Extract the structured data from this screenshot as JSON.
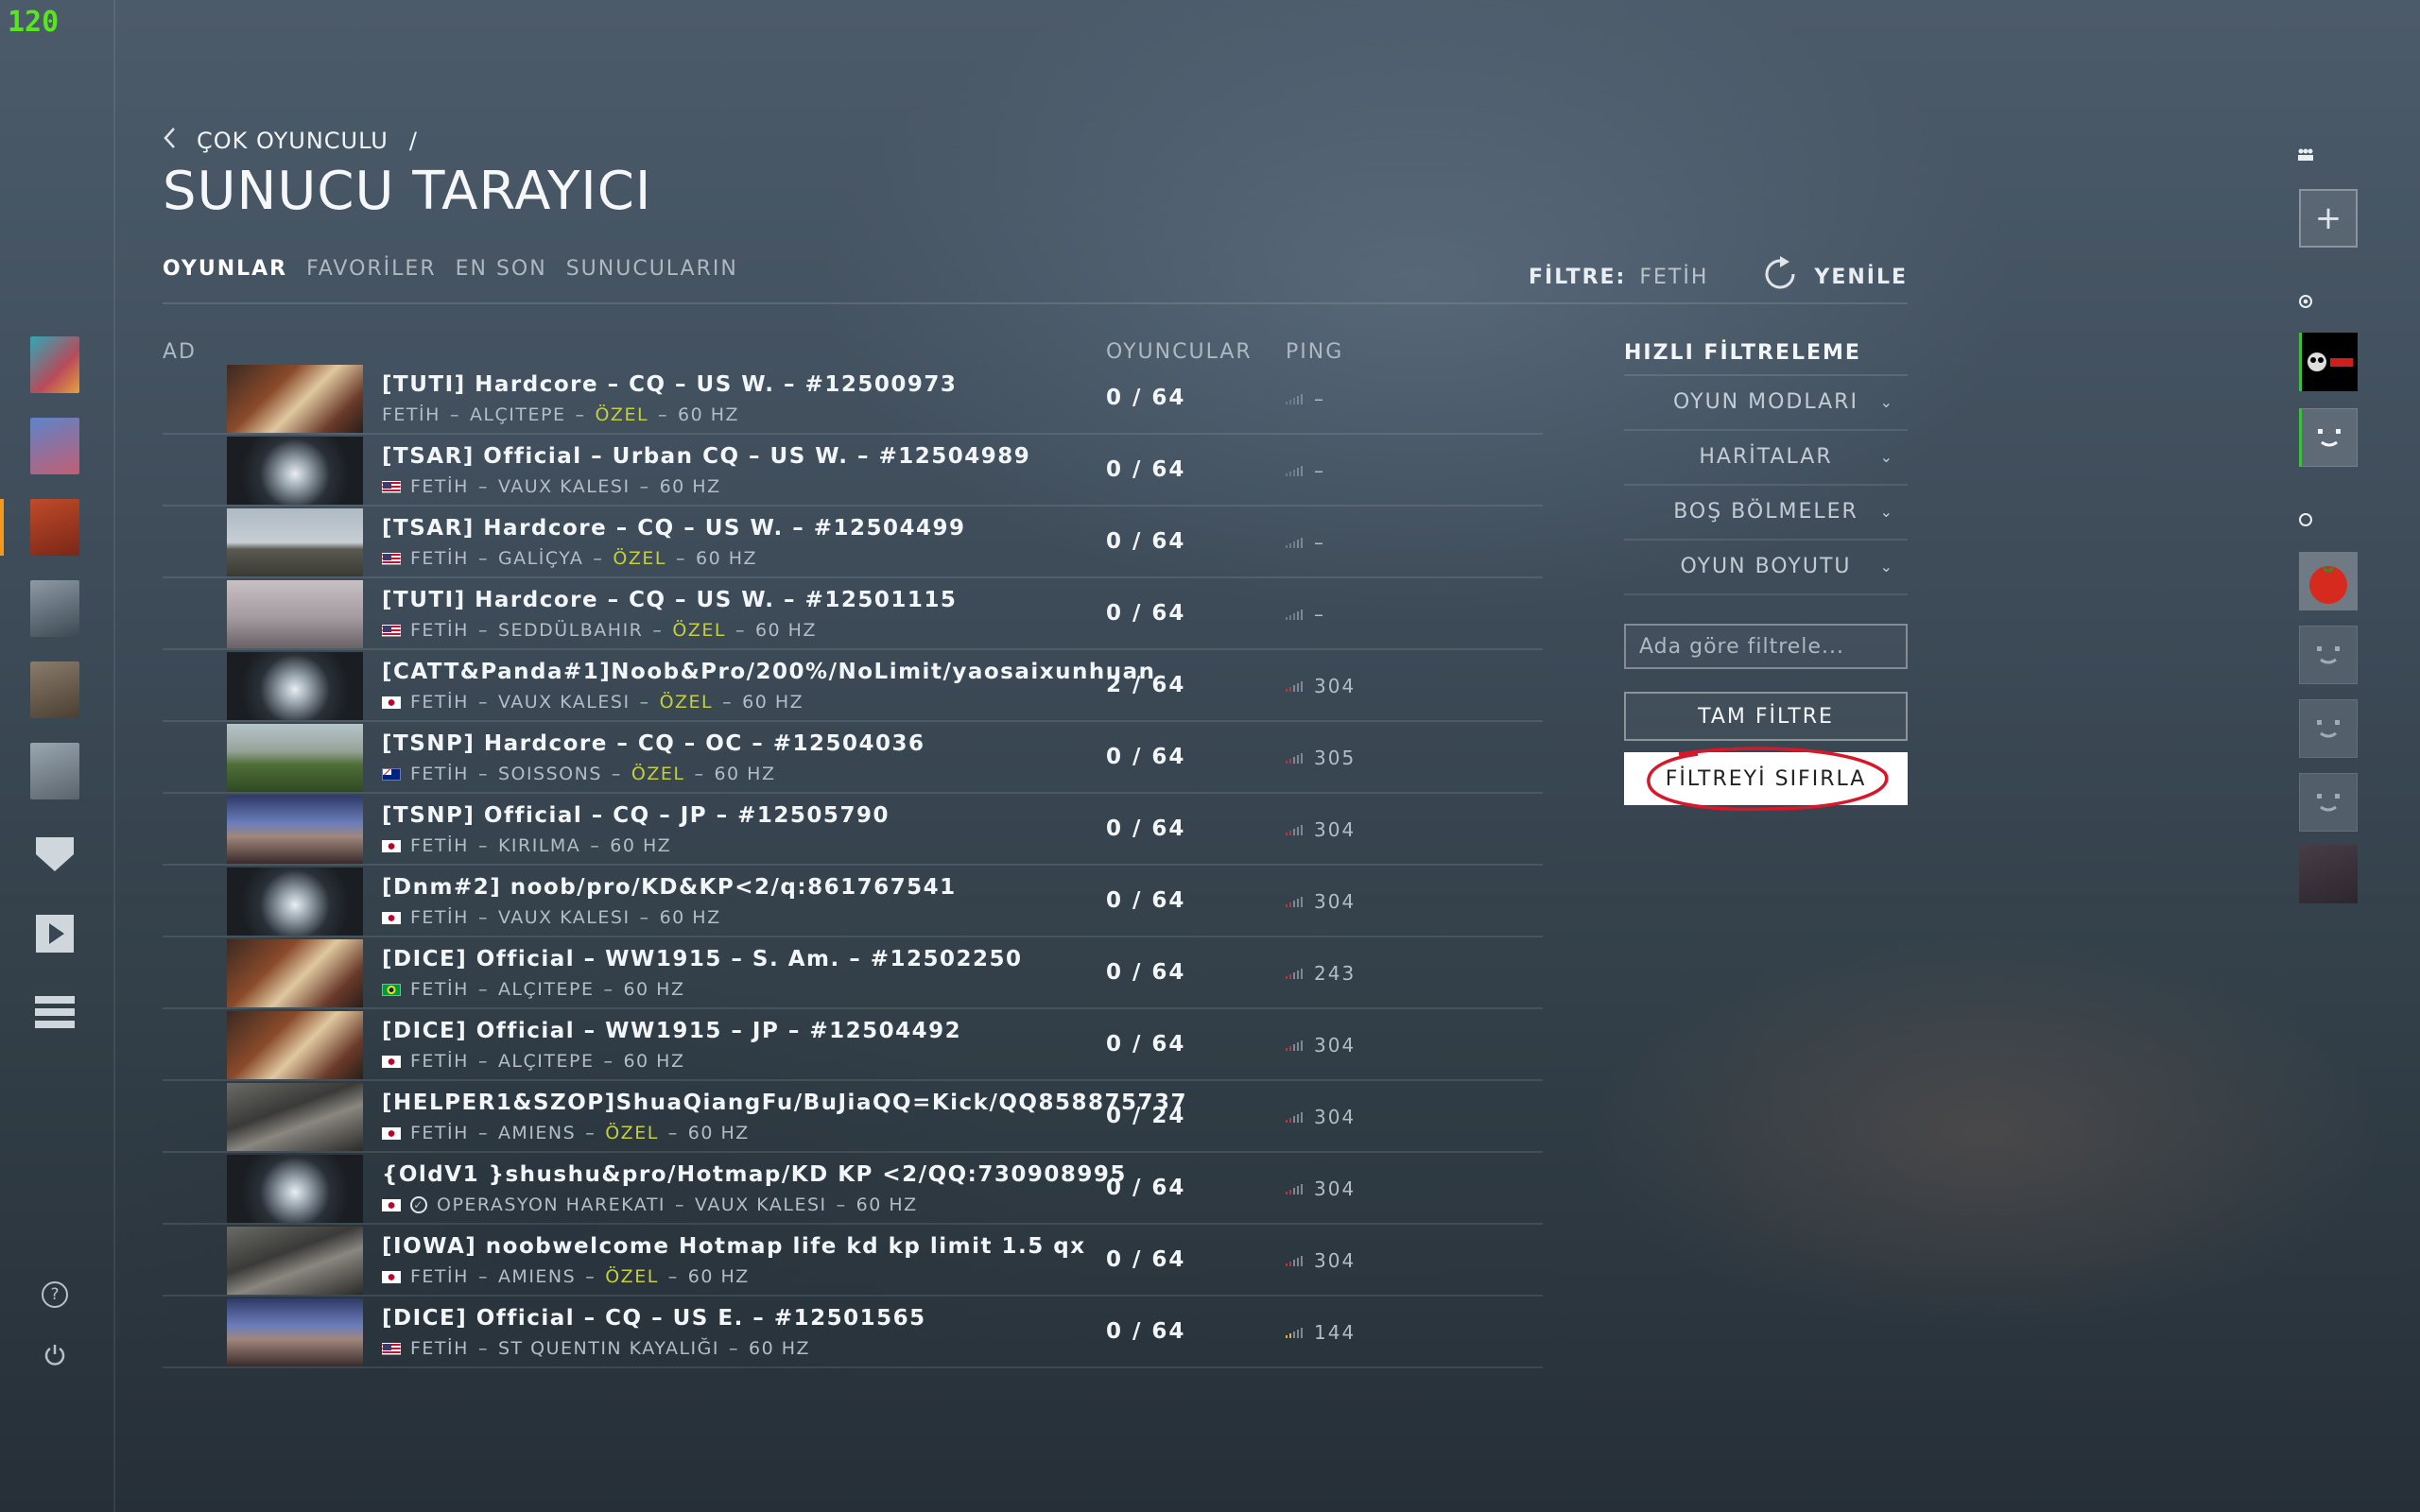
{
  "fps": "120",
  "breadcrumb": {
    "parent": "ÇOK OYUNCULU",
    "separator": "/"
  },
  "page_title": "SUNUCU TARAYICI",
  "tabs": [
    {
      "label": "OYUNLAR",
      "active": true
    },
    {
      "label": "FAVORİLER",
      "active": false
    },
    {
      "label": "EN SON",
      "active": false
    },
    {
      "label": "SUNUCULARIN",
      "active": false
    }
  ],
  "filter": {
    "label": "FİLTRE:",
    "value": "FETİH",
    "refresh_label": "YENİLE"
  },
  "columns": {
    "name": "AD",
    "players": "OYUNCULAR",
    "ping": "PING"
  },
  "servers": [
    {
      "name": "[TUTI] Hardcore – CQ – US W. – #12500973",
      "flag": "none",
      "mode": "FETİH",
      "map": "ALÇITEPE",
      "ozel": "ÖZEL",
      "hz": "60 HZ",
      "players": "0 / 64",
      "ping": "–",
      "thumb": "sunset"
    },
    {
      "name": "[TSAR] Official – Urban CQ – US W. – #12504989",
      "flag": "us",
      "mode": "FETİH",
      "map": "VAUX KALESI",
      "ozel": "",
      "hz": "60 HZ",
      "players": "0 / 64",
      "ping": "–",
      "thumb": "tunnel"
    },
    {
      "name": "[TSAR] Hardcore – CQ – US W. – #12504499",
      "flag": "us",
      "mode": "FETİH",
      "map": "GALİÇYA",
      "ozel": "ÖZEL",
      "hz": "60 HZ",
      "players": "0 / 64",
      "ping": "–",
      "thumb": "field"
    },
    {
      "name": "[TUTI] Hardcore – CQ – US W. – #12501115",
      "flag": "us",
      "mode": "FETİH",
      "map": "SEDDÜLBAHIR",
      "ozel": "ÖZEL",
      "hz": "60 HZ",
      "players": "0 / 64",
      "ping": "–",
      "thumb": "fog"
    },
    {
      "name": "[CATT&Panda#1]Noob&Pro/200%/NoLimit/yaosaixunhuan",
      "flag": "jp",
      "mode": "FETİH",
      "map": "VAUX KALESI",
      "ozel": "ÖZEL",
      "hz": "60 HZ",
      "players": "2 / 64",
      "ping": "304",
      "thumb": "tunnel"
    },
    {
      "name": "[TSNP] Hardcore – CQ – OC – #12504036",
      "flag": "au",
      "mode": "FETİH",
      "map": "SOISSONS",
      "ozel": "ÖZEL",
      "hz": "60 HZ",
      "players": "0 / 64",
      "ping": "305",
      "thumb": "green"
    },
    {
      "name": "[TSNP] Official – CQ – JP – #12505790",
      "flag": "jp",
      "mode": "FETİH",
      "map": "KIRILMA",
      "ozel": "",
      "hz": "60 HZ",
      "players": "0 / 64",
      "ping": "304",
      "thumb": "sky"
    },
    {
      "name": "[Dnm#2] noob/pro/KD&KP<2/q:861767541",
      "flag": "jp",
      "mode": "FETİH",
      "map": "VAUX KALESI",
      "ozel": "",
      "hz": "60 HZ",
      "players": "0 / 64",
      "ping": "304",
      "thumb": "tunnel"
    },
    {
      "name": "[DICE] Official – WW1915 – S. Am. – #12502250",
      "flag": "br",
      "mode": "FETİH",
      "map": "ALÇITEPE",
      "ozel": "",
      "hz": "60 HZ",
      "players": "0 / 64",
      "ping": "243",
      "thumb": "sunset"
    },
    {
      "name": "[DICE] Official – WW1915 – JP – #12504492",
      "flag": "jp",
      "mode": "FETİH",
      "map": "ALÇITEPE",
      "ozel": "",
      "hz": "60 HZ",
      "players": "0 / 64",
      "ping": "304",
      "thumb": "sunset"
    },
    {
      "name": "[HELPER1&SZOP]ShuaQiangFu/BuJiaQQ=Kick/QQ858875737",
      "flag": "jp",
      "mode": "FETİH",
      "map": "AMIENS",
      "ozel": "ÖZEL",
      "hz": "60 HZ",
      "players": "0 / 24",
      "ping": "304",
      "thumb": "town"
    },
    {
      "name": "{OldV1 }shushu&pro/Hotmap/KD KP <2/QQ:730908995",
      "flag": "jp",
      "mode": "OPERASYON HAREKATI",
      "map": "VAUX KALESI",
      "ozel": "",
      "hz": "60 HZ",
      "players": "0 / 64",
      "ping": "304",
      "thumb": "tunnel",
      "verified": true
    },
    {
      "name": "[IOWA] noobwelcome Hotmap life kd kp limit 1.5 qx",
      "flag": "jp",
      "mode": "FETİH",
      "map": "AMIENS",
      "ozel": "ÖZEL",
      "hz": "60 HZ",
      "players": "0 / 64",
      "ping": "304",
      "thumb": "town"
    },
    {
      "name": "[DICE] Official – CQ – US E. – #12501565",
      "flag": "us",
      "mode": "FETİH",
      "map": "ST QUENTIN KAYALIĞI",
      "ozel": "",
      "hz": "60 HZ",
      "players": "0 / 64",
      "ping": "144",
      "thumb": "sky"
    }
  ],
  "quick_filter": {
    "title": "HIZLI FİLTRELEME",
    "items": [
      "OYUN MODLARI",
      "HARİTALAR",
      "BOŞ BÖLMELER",
      "OYUN BOYUTU"
    ],
    "search_placeholder": "Ada göre filtrele...",
    "full_filter": "TAM FİLTRE",
    "reset_filter": "FİLTREYİ SIFIRLA"
  },
  "colors": {
    "accent": "#f39a1c",
    "ozel": "#c5cf3c",
    "annotation": "#d8182a",
    "fps": "#57e620"
  }
}
